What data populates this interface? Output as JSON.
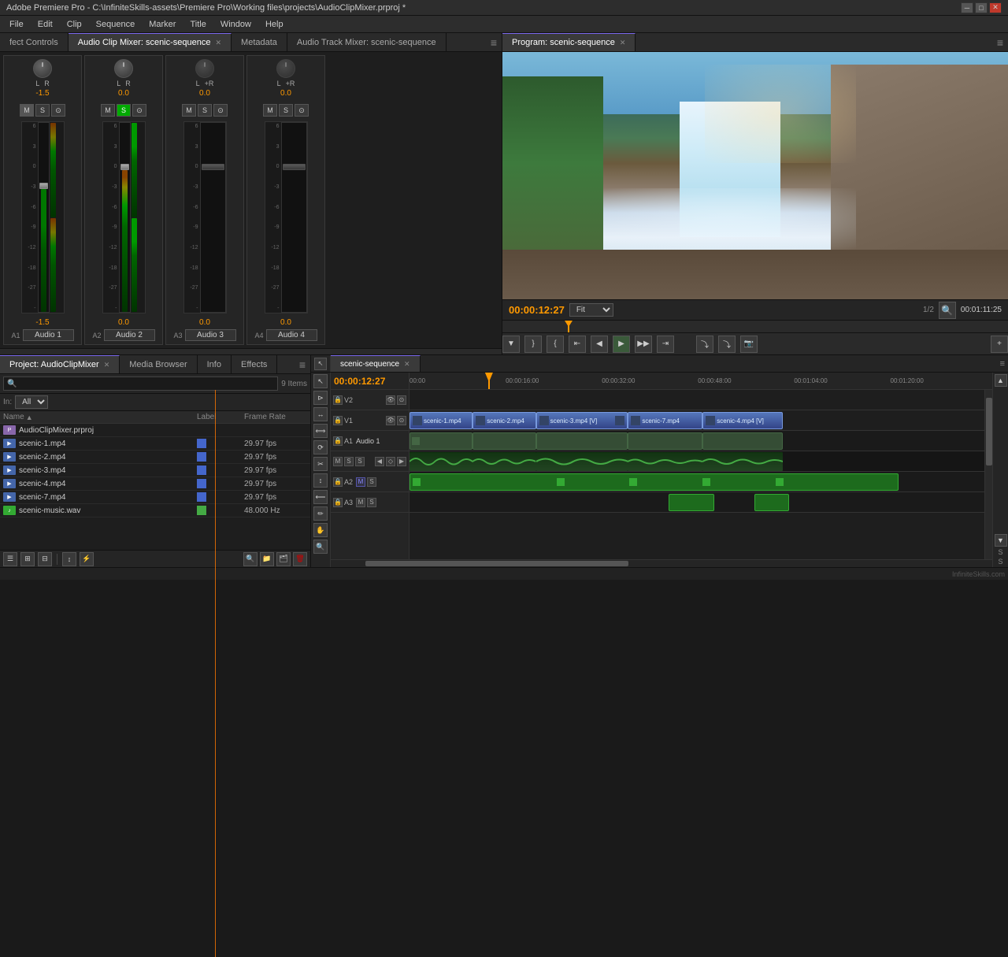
{
  "app": {
    "title": "Adobe Premiere Pro - C:\\InfiniteSkills-assets\\Premiere Pro\\Working files\\projects\\AudioClipMixer.prproj *",
    "window_buttons": [
      "minimize",
      "maximize",
      "close"
    ]
  },
  "menu": {
    "items": [
      "File",
      "Edit",
      "Clip",
      "Sequence",
      "Marker",
      "Title",
      "Window",
      "Help"
    ]
  },
  "left_panel": {
    "tabs": [
      {
        "label": "fect Controls",
        "active": false,
        "closable": false
      },
      {
        "label": "Audio Clip Mixer: scenic-sequence",
        "active": true,
        "closable": true
      },
      {
        "label": "Metadata",
        "active": false,
        "closable": false
      },
      {
        "label": "Audio Track Mixer: scenic-sequence",
        "active": false,
        "closable": false
      }
    ],
    "channels": [
      {
        "id": "A1",
        "name": "Audio 1",
        "value": "-1.5",
        "vol": "-1.5",
        "s_active": false,
        "m_active": false,
        "fader_pct": 72,
        "lr": "L   R"
      },
      {
        "id": "A2",
        "name": "Audio 2",
        "value": "0.0",
        "vol": "0.0",
        "s_active": true,
        "m_active": false,
        "fader_pct": 80,
        "lr": "L   R"
      },
      {
        "id": "A3",
        "name": "Audio 3",
        "value": "0.0",
        "vol": "0.0",
        "s_active": false,
        "m_active": false,
        "fader_pct": 80,
        "lr": "L+R"
      },
      {
        "id": "A4",
        "name": "Audio 4",
        "value": "0.0",
        "vol": "0.0",
        "s_active": false,
        "m_active": false,
        "fader_pct": 80,
        "lr": "L+R"
      }
    ],
    "db_labels": [
      "6",
      "3",
      "0",
      "-3",
      "-6",
      "-9",
      "-12",
      "-18",
      "-27",
      "-"
    ]
  },
  "project_panel": {
    "tabs": [
      {
        "label": "Project: AudioClipMixer",
        "active": true,
        "closable": true
      },
      {
        "label": "Media Browser",
        "active": false
      },
      {
        "label": "Info",
        "active": false
      },
      {
        "label": "Effects",
        "active": false
      }
    ],
    "items_count": "9 Items",
    "search_placeholder": "",
    "in_label": "In:",
    "in_value": "All",
    "columns": [
      {
        "label": "Name",
        "sort": "asc"
      },
      {
        "label": "Label"
      },
      {
        "label": "Frame Rate"
      }
    ],
    "files": [
      {
        "name": "AudioClipMixer.prproj",
        "label": null,
        "fps": "",
        "type": "project"
      },
      {
        "name": "scenic-1.mp4",
        "label": "blue",
        "fps": "29.97 fps",
        "type": "video"
      },
      {
        "name": "scenic-2.mp4",
        "label": "blue",
        "fps": "29.97 fps",
        "type": "video"
      },
      {
        "name": "scenic-3.mp4",
        "label": "blue",
        "fps": "29.97 fps",
        "type": "video"
      },
      {
        "name": "scenic-4.mp4",
        "label": "blue",
        "fps": "29.97 fps",
        "type": "video"
      },
      {
        "name": "scenic-7.mp4",
        "label": "blue",
        "fps": "29.97 fps",
        "type": "video"
      },
      {
        "name": "scenic-music.wav",
        "label": "green",
        "fps": "48.000 Hz",
        "type": "audio"
      }
    ]
  },
  "timeline": {
    "tab_label": "scenic-sequence",
    "timecode": "00:00:12:27",
    "tracks": [
      {
        "id": "V2",
        "type": "video",
        "clips": []
      },
      {
        "id": "V1",
        "type": "video",
        "clips": [
          {
            "label": "scenic-1.mp4",
            "left_pct": 0,
            "width_pct": 11
          },
          {
            "label": "scenic-2.mp4",
            "left_pct": 11,
            "width_pct": 11
          },
          {
            "label": "scenic-3.mp4 [V]",
            "left_pct": 22,
            "width_pct": 16
          },
          {
            "label": "scenic-7.mp4",
            "left_pct": 38,
            "width_pct": 13
          },
          {
            "label": "scenic-4.mp4 [V]",
            "left_pct": 51,
            "width_pct": 14
          }
        ]
      },
      {
        "id": "A1",
        "name": "Audio 1",
        "type": "audio",
        "clips": [
          {
            "left_pct": 0,
            "width_pct": 11
          },
          {
            "left_pct": 11,
            "width_pct": 11
          },
          {
            "left_pct": 22,
            "width_pct": 16
          },
          {
            "left_pct": 38,
            "width_pct": 13
          },
          {
            "left_pct": 51,
            "width_pct": 14
          }
        ]
      },
      {
        "id": "A2",
        "type": "audio",
        "clips": [
          {
            "left_pct": 0,
            "width_pct": 85
          }
        ]
      },
      {
        "id": "A3",
        "type": "audio",
        "clips": []
      }
    ],
    "ruler_times": [
      "00:00",
      "00:00:16:00",
      "00:00:32:00",
      "00:00:48:00",
      "00:01:04:00",
      "00:01:20:00"
    ],
    "playhead_pct": 13.5
  },
  "program_monitor": {
    "title": "Program: scenic-sequence",
    "timecode_current": "00:00:12:27",
    "timecode_duration": "00:01:11:25",
    "fit_label": "Fit",
    "resolution": "1/2",
    "playback_buttons": [
      "mark-in",
      "mark-out",
      "set-in",
      "go-prev",
      "step-back",
      "play",
      "step-fwd",
      "go-next",
      "set-out",
      "insert",
      "overwrite",
      "camera"
    ]
  },
  "colors": {
    "accent_orange": "#ff9900",
    "accent_blue": "#7b68ee",
    "clip_video": "#5577bb",
    "clip_audio": "#447744",
    "active_green": "#00aa00"
  },
  "icons": {
    "search": "🔍",
    "chevron_down": "▾",
    "close": "✕",
    "play": "▶",
    "pause": "⏸",
    "step_back": "◀",
    "step_fwd": "▶",
    "rewind": "⏮",
    "ff": "⏭",
    "mark_in": "▼",
    "mark_out": "▼",
    "camera": "📷"
  }
}
